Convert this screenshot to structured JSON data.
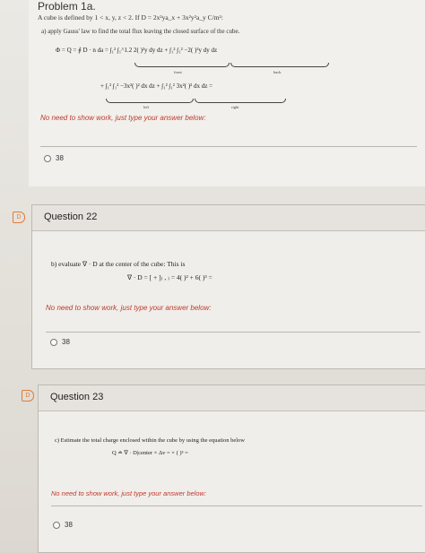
{
  "problem": {
    "title": "Problem 1a.",
    "statement": "A cube is defined by 1 < x, y, z < 2. If D = 2x²ya_x + 3x²y²a_y C/m²:",
    "part_a": "a) apply Gauss' law to find the total flux leaving the closed surface of the cube.",
    "flux_eq_line1": "Φ = Q = ∮ D · n da   = ∫₁² ∫₁^1.2 2(   )²y dy dz +  ∫₁² ∫₁² −2(   )²y dy dz",
    "flux_eq_line2": "+ ∫₁² ∫₁² −3x²(   )² dx dz +  ∫₁² ∫₁² 3x²(   )² dx dz =",
    "label_front": "front",
    "label_back": "back",
    "label_left": "left",
    "label_right": "right",
    "note": "No need to show work, just type your answer below:",
    "answer": "38"
  },
  "questions": [
    {
      "number": "D",
      "title": "Question 22",
      "prompt": "b) evaluate ∇ · D at the center of the cube: This is",
      "equation": "∇ · D = [    +    ]₍   ,   ₎ = 4(   )² + 6(   )³ =",
      "note": "No need to show work, just type your answer below:",
      "answer": "38"
    },
    {
      "number": "D",
      "title": "Question 23",
      "prompt": "c) Estimate the total charge enclosed within the cube by using the equation below",
      "equation": "Q ≐ ∇ · D|center × Δv =        × (   )³ =",
      "note": "No need to show work, just type your answer below:",
      "answer": "38"
    }
  ],
  "colors": {
    "note_red": "#c0392b",
    "flag_orange": "#e07b39"
  }
}
